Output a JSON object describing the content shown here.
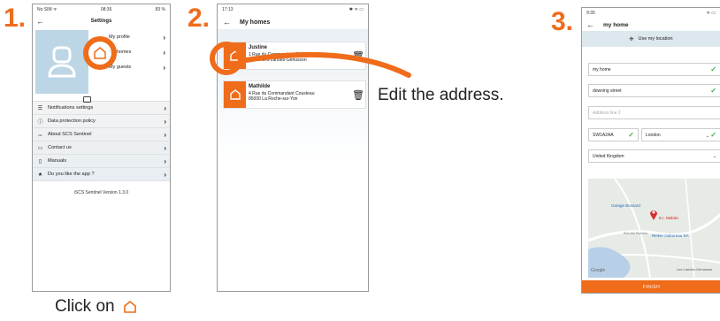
{
  "steps": {
    "s1": "1.",
    "s2": "2.",
    "s3": "3."
  },
  "phone1": {
    "status": {
      "carrier": "No SIM ᯤ",
      "time": "08:36",
      "battery": "83 %"
    },
    "title": "Settings",
    "profile": [
      {
        "label": "My profile"
      },
      {
        "label": "My homes"
      },
      {
        "label": "My guests"
      }
    ],
    "menu": [
      {
        "icon": "sliders-icon",
        "glyph": "☰",
        "label": "Notifications settings"
      },
      {
        "icon": "info-icon",
        "glyph": "ⓘ",
        "label": "Data protection policy"
      },
      {
        "icon": "dots-icon",
        "glyph": "•••",
        "label": "About SCS Sentinel"
      },
      {
        "icon": "chat-icon",
        "glyph": "▭",
        "label": "Contact us"
      },
      {
        "icon": "document-icon",
        "glyph": "▯",
        "label": "Manuals"
      },
      {
        "icon": "star-icon",
        "glyph": "★",
        "label": "Do you like the app ?"
      }
    ],
    "version": "iSCS Sentinel Version 1.3.0"
  },
  "phone2": {
    "status": {
      "time": "17:13",
      "icons": "✱ ᯤ ▭"
    },
    "title": "My homes",
    "homes": [
      {
        "name": "Justine",
        "line1": "1 Rue du Commandant Cousteau",
        "line2": "85130 Les Landes-Genusson"
      },
      {
        "name": "Mathilde",
        "line1": "4 Rue du Commandant Cousteau",
        "line2": "85000 La Roche-sur-Yon"
      }
    ]
  },
  "caption2": "Edit the address.",
  "phone3": {
    "status": {
      "time": "9:35",
      "icons": "ᯤ ▭"
    },
    "title": "my home",
    "use_location": "Use my location",
    "fields": {
      "name": "my home",
      "street": "downing street",
      "line2_placeholder": "Address line 2",
      "postcode": "SW1A2AA",
      "city": "London",
      "country": "United Kingdom"
    },
    "map": {
      "poi1": "Garage Bossard",
      "poi2": "E.I. Maldec",
      "poi3": "Rieker Gaboreau SA",
      "road": "Rue des Ruchers",
      "town": "Les Landes-Genusson",
      "brand": "Google"
    },
    "finish": "FINISH"
  },
  "caption1": "Click on",
  "colors": {
    "accent": "#ef6c1a",
    "check": "#36b34a"
  }
}
